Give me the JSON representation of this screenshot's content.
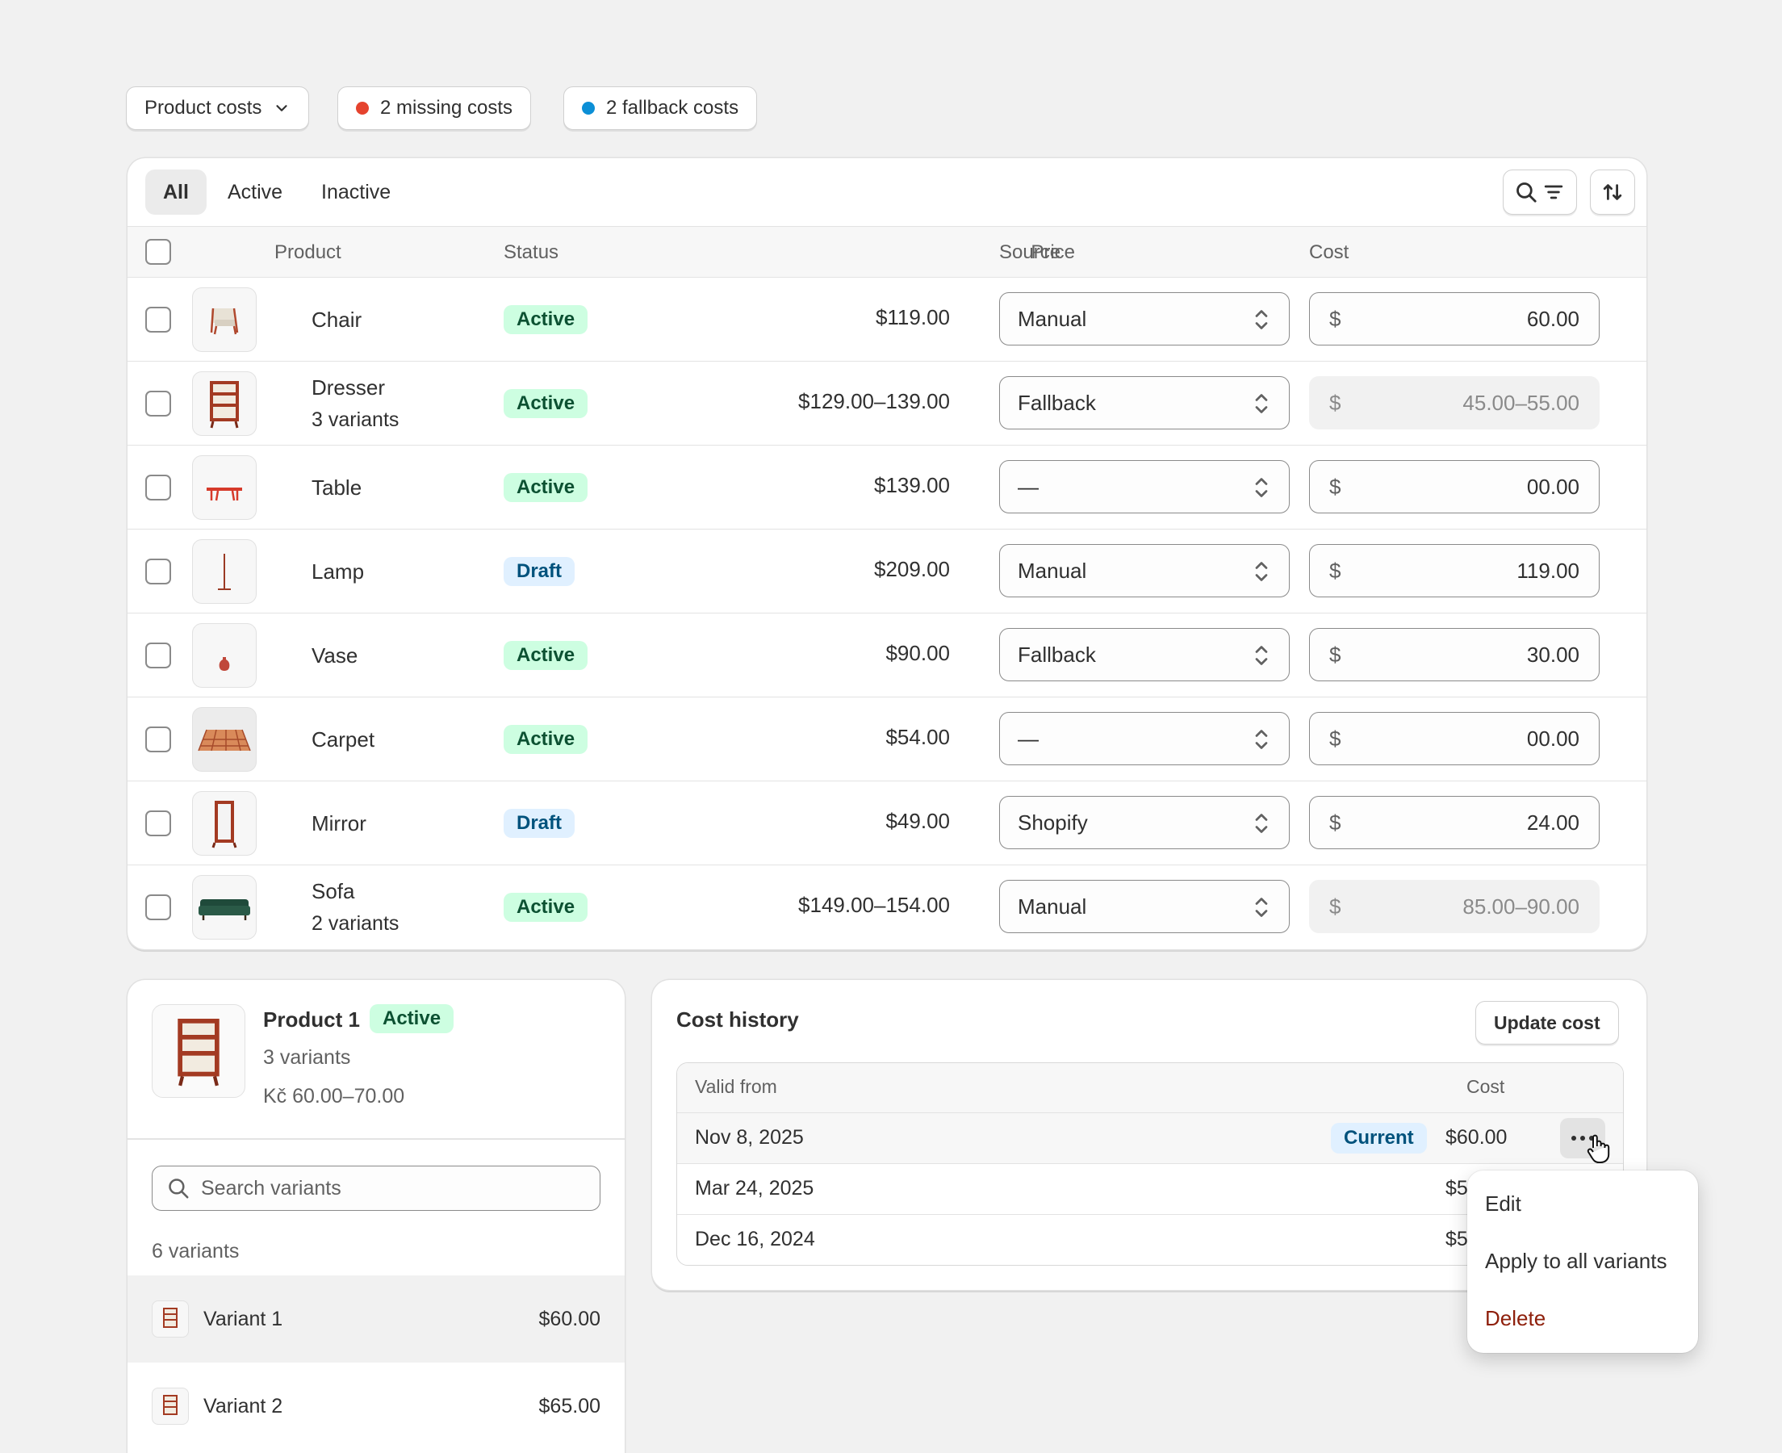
{
  "filters": {
    "product_costs": "Product costs",
    "missing": "2 missing costs",
    "fallback": "2 fallback costs",
    "missing_color": "#e5432e",
    "fallback_color": "#0b8fd6"
  },
  "tabs": [
    "All",
    "Active",
    "Inactive"
  ],
  "table": {
    "headers": {
      "product": "Product",
      "status": "Status",
      "price": "Price",
      "source": "Source",
      "cost": "Cost"
    },
    "currency": "$",
    "rows": [
      {
        "name": "Chair",
        "variants": "",
        "status": "Active",
        "price": "$119.00",
        "source": "Manual",
        "cost": "60.00",
        "cost_disabled": false
      },
      {
        "name": "Dresser",
        "variants": "3 variants",
        "status": "Active",
        "price": "$129.00–139.00",
        "source": "Fallback",
        "cost": "45.00–55.00",
        "cost_disabled": true
      },
      {
        "name": "Table",
        "variants": "",
        "status": "Active",
        "price": "$139.00",
        "source": "—",
        "cost": "00.00",
        "cost_disabled": false
      },
      {
        "name": "Lamp",
        "variants": "",
        "status": "Draft",
        "price": "$209.00",
        "source": "Manual",
        "cost": "119.00",
        "cost_disabled": false
      },
      {
        "name": "Vase",
        "variants": "",
        "status": "Active",
        "price": "$90.00",
        "source": "Fallback",
        "cost": "30.00",
        "cost_disabled": false
      },
      {
        "name": "Carpet",
        "variants": "",
        "status": "Active",
        "price": "$54.00",
        "source": "—",
        "cost": "00.00",
        "cost_disabled": false
      },
      {
        "name": "Mirror",
        "variants": "",
        "status": "Draft",
        "price": "$49.00",
        "source": "Shopify",
        "cost": "24.00",
        "cost_disabled": false
      },
      {
        "name": "Sofa",
        "variants": "2 variants",
        "status": "Active",
        "price": "$149.00–154.00",
        "source": "Manual",
        "cost": "85.00–90.00",
        "cost_disabled": true
      }
    ]
  },
  "product_detail": {
    "title": "Product 1",
    "status": "Active",
    "variants": "3 variants",
    "price_range": "Kč 60.00–70.00",
    "search_placeholder": "Search variants",
    "count_label": "6 variants",
    "variant_list": [
      {
        "name": "Variant 1",
        "price": "$60.00"
      },
      {
        "name": "Variant 2",
        "price": "$65.00"
      }
    ]
  },
  "cost_history": {
    "title": "Cost history",
    "update_button": "Update cost",
    "col_valid_from": "Valid from",
    "col_cost": "Cost",
    "current_badge": "Current",
    "rows": [
      {
        "date": "Nov 8, 2025",
        "cost": "$60.00"
      },
      {
        "date": "Mar 24, 2025",
        "cost": "$5"
      },
      {
        "date": "Dec 16, 2024",
        "cost": "$5"
      }
    ]
  },
  "context_menu": {
    "edit": "Edit",
    "apply_all": "Apply to all variants",
    "delete": "Delete"
  }
}
